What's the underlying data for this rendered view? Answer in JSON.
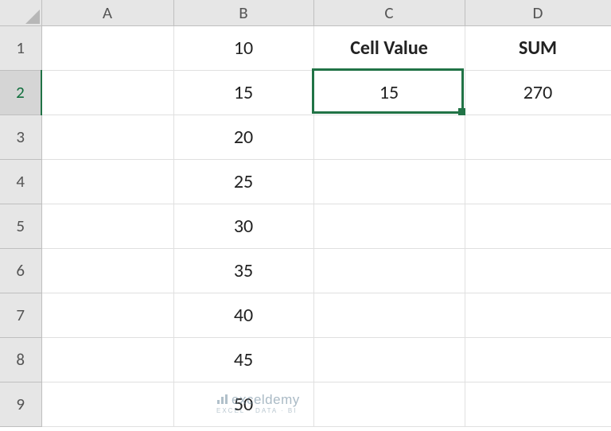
{
  "columns": [
    "A",
    "B",
    "C",
    "D"
  ],
  "rows": [
    "1",
    "2",
    "3",
    "4",
    "5",
    "6",
    "7",
    "8",
    "9"
  ],
  "active_row_index": 1,
  "selected_cell": "C2",
  "cells": {
    "B1": "10",
    "B2": "15",
    "B3": "20",
    "B4": "25",
    "B5": "30",
    "B6": "35",
    "B7": "40",
    "B8": "45",
    "B9": "50",
    "C1": "Cell Value",
    "C2": "15",
    "D1": "SUM",
    "D2": "270"
  },
  "bold_cells": [
    "C1",
    "D1"
  ],
  "watermark": {
    "brand": "exceldemy",
    "tagline": "EXCEL · DATA · BI"
  },
  "colors": {
    "selection": "#217346",
    "header_bg": "#e6e6e6",
    "grid": "#e0e0e0"
  },
  "chart_data": {
    "type": "table",
    "columns": [
      "A",
      "B",
      "C",
      "D"
    ],
    "rows": [
      {
        "A": "",
        "B": 10,
        "C": "Cell Value",
        "D": "SUM"
      },
      {
        "A": "",
        "B": 15,
        "C": 15,
        "D": 270
      },
      {
        "A": "",
        "B": 20,
        "C": "",
        "D": ""
      },
      {
        "A": "",
        "B": 25,
        "C": "",
        "D": ""
      },
      {
        "A": "",
        "B": 30,
        "C": "",
        "D": ""
      },
      {
        "A": "",
        "B": 35,
        "C": "",
        "D": ""
      },
      {
        "A": "",
        "B": 40,
        "C": "",
        "D": ""
      },
      {
        "A": "",
        "B": 45,
        "C": "",
        "D": ""
      },
      {
        "A": "",
        "B": 50,
        "C": "",
        "D": ""
      }
    ]
  }
}
